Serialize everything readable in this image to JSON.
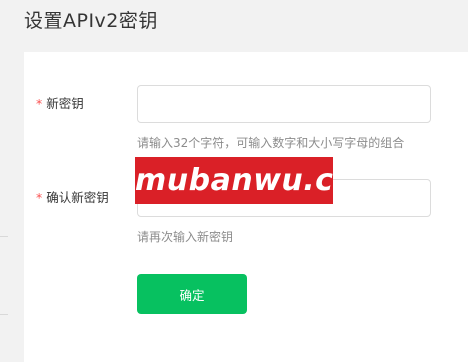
{
  "page": {
    "title": "设置APIv2密钥"
  },
  "form": {
    "required_mark": "*",
    "new_key": {
      "label": "新密钥",
      "value": "",
      "placeholder": "",
      "hint": "请输入32个字符，可输入数字和大小写字母的组合"
    },
    "confirm_key": {
      "label": "确认新密钥",
      "value": "",
      "placeholder": "",
      "hint": "请再次输入新密钥"
    },
    "confirm_button_label": "确定"
  },
  "watermark": {
    "text": "mubanwu.cc",
    "background_color": "#da2027"
  },
  "colors": {
    "primary": "#07c160",
    "required": "#fa5151",
    "hint": "#8c8c8c"
  }
}
